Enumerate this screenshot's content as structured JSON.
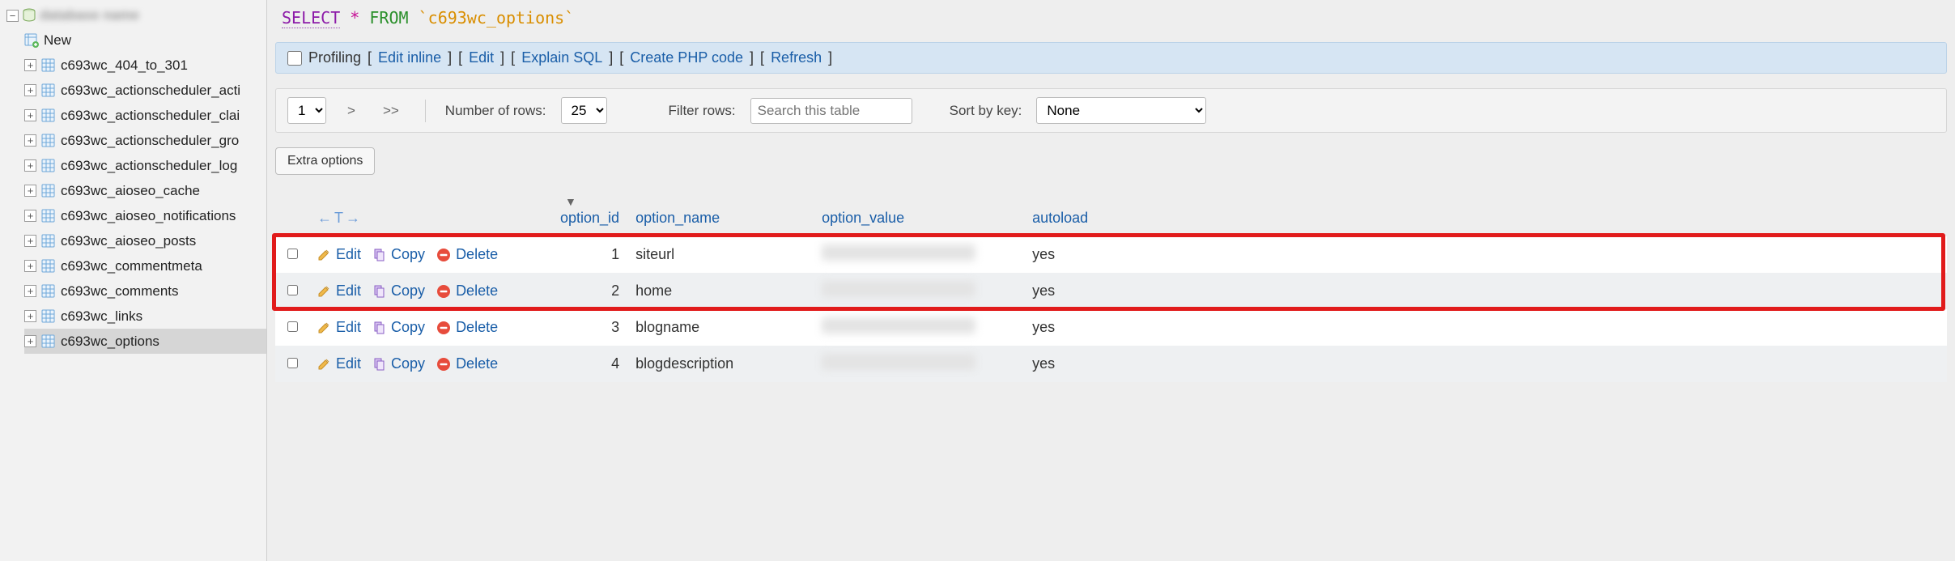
{
  "sidebar": {
    "root_blurred": "database name",
    "new_label": "New",
    "tables": [
      "c693wc_404_to_301",
      "c693wc_actionscheduler_acti",
      "c693wc_actionscheduler_clai",
      "c693wc_actionscheduler_gro",
      "c693wc_actionscheduler_log",
      "c693wc_aioseo_cache",
      "c693wc_aioseo_notifications",
      "c693wc_aioseo_posts",
      "c693wc_commentmeta",
      "c693wc_comments",
      "c693wc_links",
      "c693wc_options"
    ],
    "selected_index": 11
  },
  "sql": {
    "select": "SELECT",
    "star": "*",
    "from": "FROM",
    "table": "`c693wc_options`"
  },
  "action_bar": {
    "profiling": "Profiling",
    "edit_inline": "Edit inline",
    "edit": "Edit",
    "explain": "Explain SQL",
    "create_php": "Create PHP code",
    "refresh": "Refresh"
  },
  "controls": {
    "page_value": "1",
    "nav_next": ">",
    "nav_last": ">>",
    "num_rows_label": "Number of rows:",
    "num_rows_value": "25",
    "filter_label": "Filter rows:",
    "filter_placeholder": "Search this table",
    "sort_label": "Sort by key:",
    "sort_value": "None"
  },
  "extra_options_label": "Extra options",
  "table": {
    "header_arrows": "←T→",
    "col_option_id": "option_id",
    "col_option_name": "option_name",
    "col_option_value": "option_value",
    "col_autoload": "autoload",
    "edit_label": "Edit",
    "copy_label": "Copy",
    "delete_label": "Delete",
    "rows": [
      {
        "option_id": "1",
        "option_name": "siteurl",
        "autoload": "yes"
      },
      {
        "option_id": "2",
        "option_name": "home",
        "autoload": "yes"
      },
      {
        "option_id": "3",
        "option_name": "blogname",
        "autoload": "yes"
      },
      {
        "option_id": "4",
        "option_name": "blogdescription",
        "autoload": "yes"
      }
    ]
  }
}
